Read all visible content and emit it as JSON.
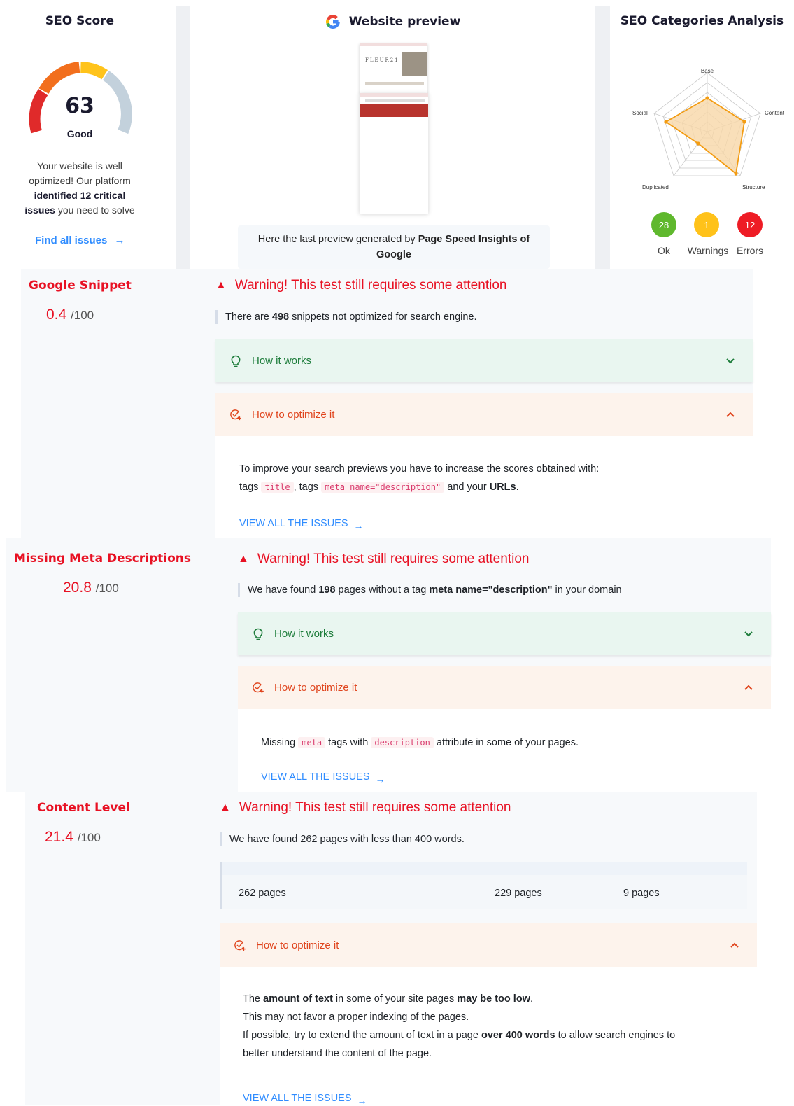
{
  "score_panel": {
    "title": "SEO Score",
    "score": "63",
    "score_label": "Good",
    "desc_line1": "Your website is well",
    "desc_line2": "optimized! Our platform",
    "desc_bold1": "identified 12 critical",
    "desc_bold2": "issues",
    "desc_tail": " you need to solve",
    "link": "Find all issues"
  },
  "preview_panel": {
    "title": "Website preview",
    "brand_mock": "FLEUR21",
    "caption_prefix": "Here the last preview generated by ",
    "caption_bold1": "Page Speed Insights of",
    "caption_bold2": "Google"
  },
  "categories_panel": {
    "title": "SEO Categories Analysis",
    "axes": [
      "Base",
      "Content",
      "Structure",
      "Duplicated",
      "Social"
    ],
    "ok_count": "28",
    "warnings_count": "1",
    "errors_count": "12",
    "ok_label": "Ok",
    "warnings_label": "Warnings",
    "errors_label": "Errors",
    "colors": {
      "ok": "#5fb82d",
      "warning": "#ffc21a",
      "error": "#ee1c25",
      "radar": "#f39c12"
    }
  },
  "sections": [
    {
      "title": "Google Snippet",
      "score": "0.4",
      "score_max": "/100",
      "warning": "Warning! This test still requires some attention",
      "summary_pre": "There are ",
      "summary_num": "498",
      "summary_post": " snippets not optimized for search engine.",
      "how_label": "How it works",
      "opt_label": "How to optimize it",
      "body_line1": "To improve your search previews you have to increase the scores obtained with:",
      "body_l2_a": "tags ",
      "body_code1": "title",
      "body_l2_b": ", tags ",
      "body_code2": "meta name=\"description\"",
      "body_l2_c": " and your ",
      "body_l2_bold": "URLs",
      "body_l2_d": ".",
      "view_all": "VIEW ALL THE ISSUES"
    },
    {
      "title": "Missing Meta Descriptions",
      "score": "20.8",
      "score_max": "/100",
      "warning": "Warning! This test still requires some attention",
      "summary_pre": "We have found ",
      "summary_num": "198",
      "summary_mid": " pages without a tag ",
      "summary_bold": "meta name=\"description\"",
      "summary_post": " in your domain",
      "how_label": "How it works",
      "opt_label": "How to optimize it",
      "body_a": "Missing ",
      "body_code1": "meta",
      "body_b": " tags with ",
      "body_code2": "description",
      "body_c": " attribute in some of your pages.",
      "view_all": "VIEW ALL THE ISSUES"
    },
    {
      "title": "Content Level",
      "score": "21.4",
      "score_max": "/100",
      "warning": "Warning! This test still requires some attention",
      "summary": "We have found 262 pages with less than 400 words.",
      "stats": [
        "262 pages",
        "229 pages",
        "9 pages"
      ],
      "opt_label": "How to optimize it",
      "p1_a": "The ",
      "p1_b1": "amount of text",
      "p1_c": " in some of your site pages ",
      "p1_b2": "may be too low",
      "p1_d": ".",
      "p2": "This may not favor a proper indexing of the pages.",
      "p3_a": "If possible, try to extend the amount of text in a page ",
      "p3_b": "over 400 words",
      "p3_c": " to allow search engines to",
      "p4": "better understand the content of the page.",
      "view_all": "VIEW ALL THE ISSUES"
    }
  ]
}
